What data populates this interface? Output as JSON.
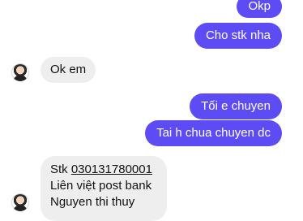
{
  "messages": {
    "m1": "Okp",
    "m2": "Cho stk nha",
    "m3": "Ok em",
    "m4": "Tối e chuyen",
    "m5": "Tai h chua chuyen dc",
    "m6": {
      "prefix": "Stk ",
      "account": "030131780001",
      "line2": "Liên việt post bank",
      "line3": "Nguyen thi thuy"
    }
  },
  "colors": {
    "outgoing_bubble": "#5d4cf3",
    "incoming_bubble": "#eeeeef"
  }
}
